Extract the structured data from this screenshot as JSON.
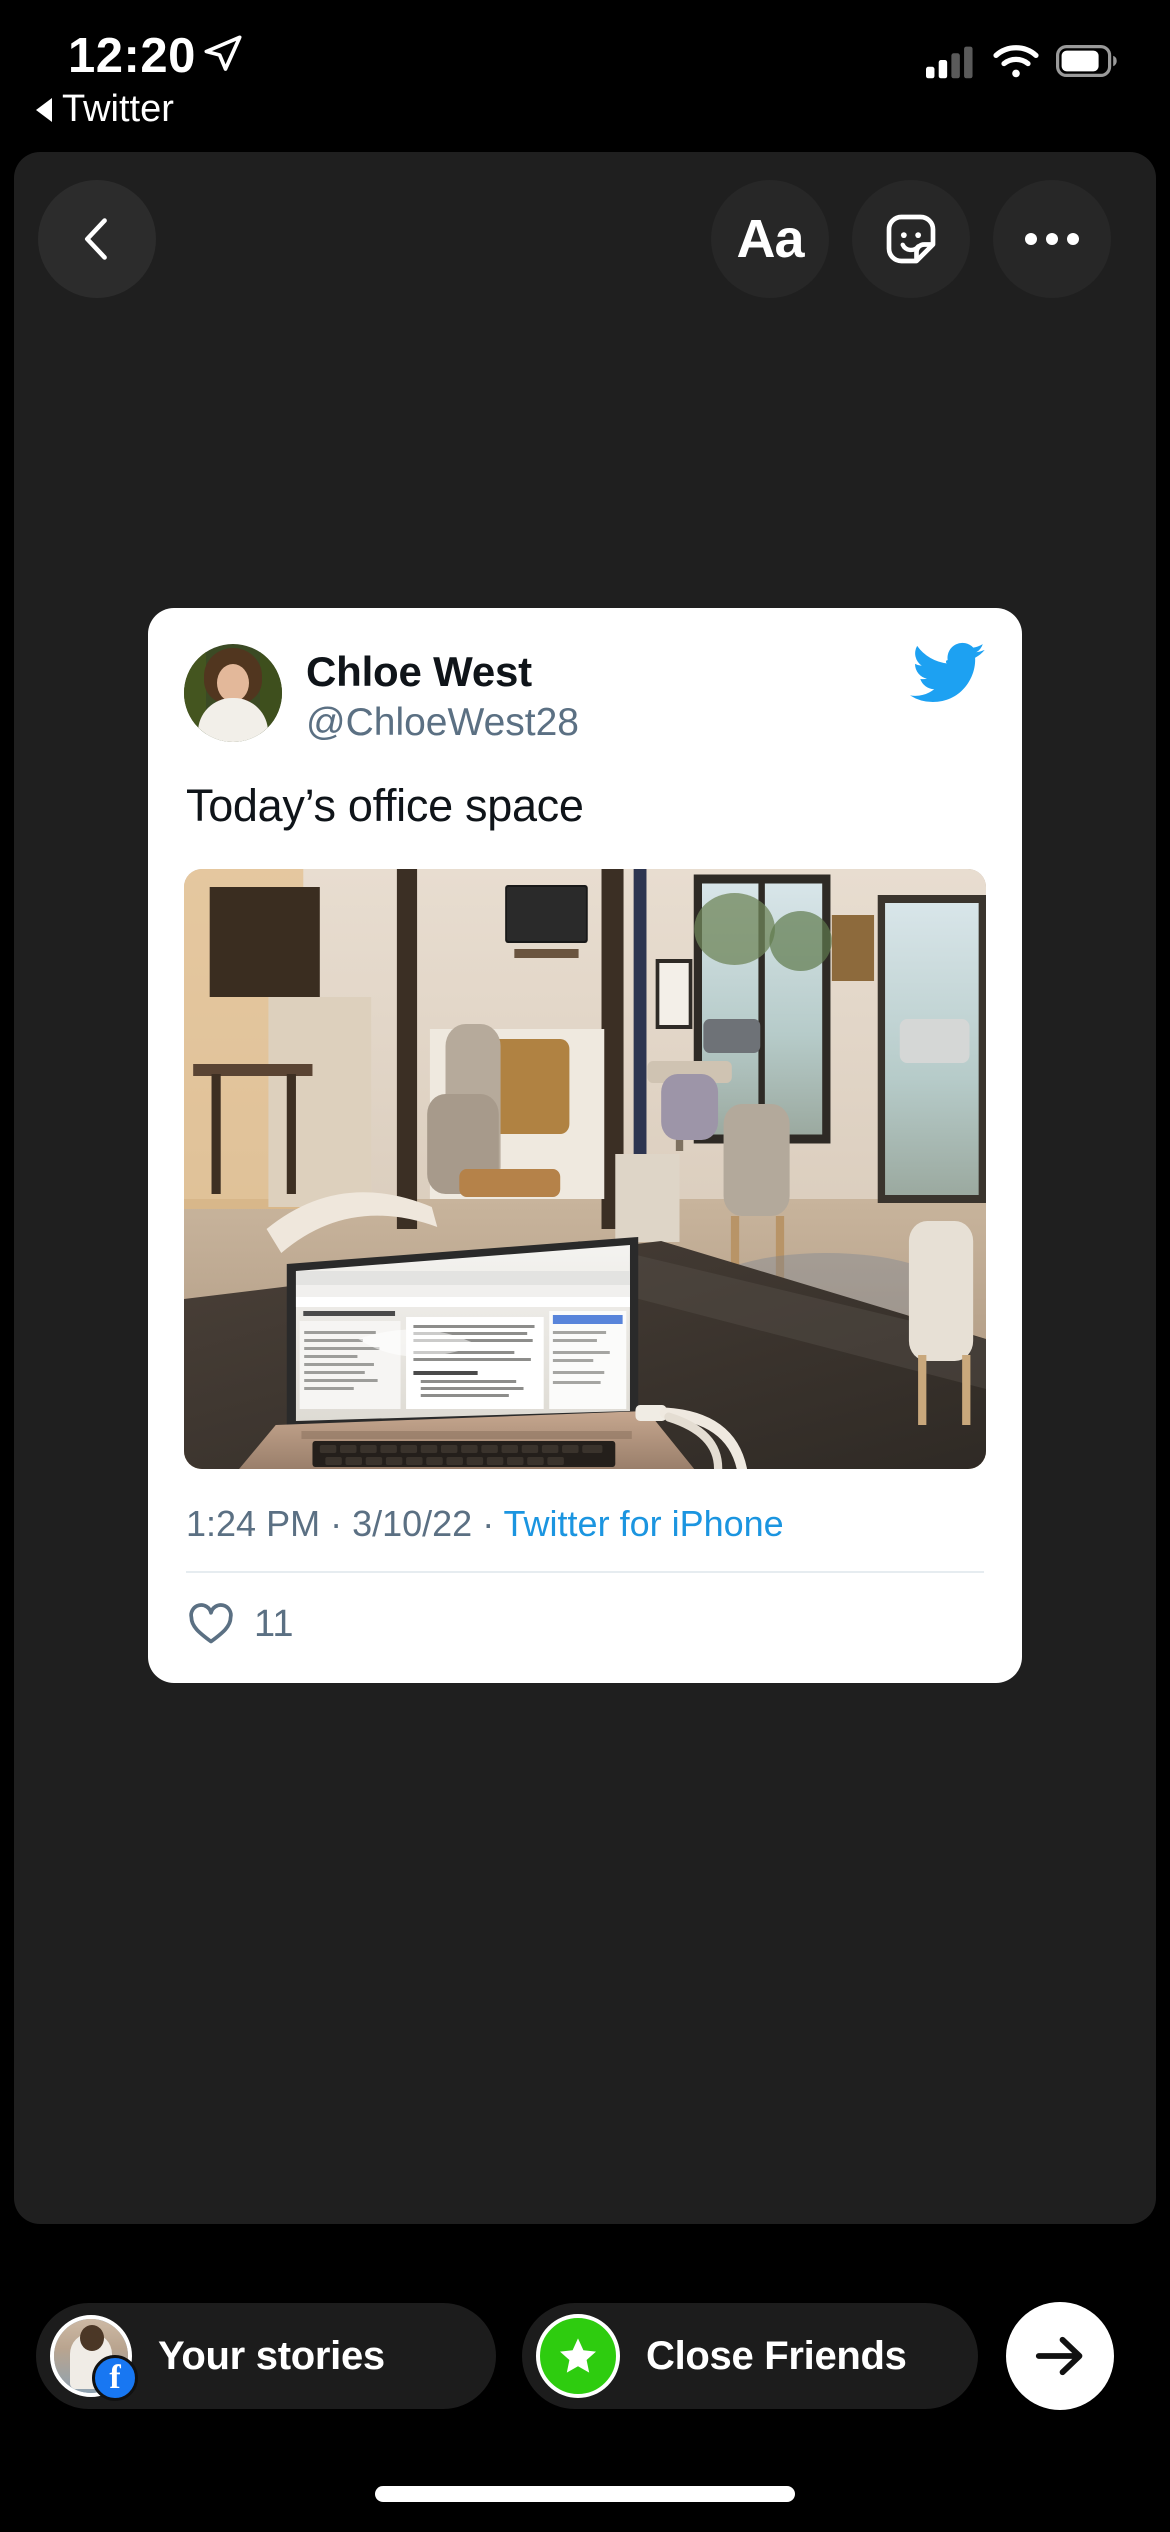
{
  "status_bar": {
    "time": "12:20",
    "location_icon": "location-arrow-icon",
    "back_app_label": "Twitter",
    "cellular_icon": "cellular-signal-icon",
    "cellular_bars_filled": 2,
    "cellular_bars_total": 4,
    "wifi_icon": "wifi-icon",
    "battery_icon": "battery-icon",
    "battery_level_pct": 78
  },
  "story_header": {
    "back_label": "back-chevron-icon",
    "text_tool_label": "Aa",
    "sticker_label": "sticker-icon",
    "more_label": "more-options-icon"
  },
  "tweet_card": {
    "display_name": "Chloe West",
    "handle": "@ChloeWest28",
    "logo": "twitter-bird-icon",
    "text": "Today’s office space",
    "photo_alt": "MacBook Pro open on a dark desk in a bright coworking lounge",
    "time": "1:24 PM",
    "separator_1": " · ",
    "date": "3/10/22",
    "separator_2": " · ",
    "source": "Twitter for iPhone",
    "like_icon": "heart-outline-icon",
    "like_count": "11"
  },
  "bottom_bar": {
    "your_stories_label": "Your stories",
    "your_stories_badge": "facebook-badge-icon",
    "facebook_letter": "f",
    "close_friends_label": "Close Friends",
    "close_friends_badge": "green-star-icon",
    "send_label": "send-arrow-icon"
  },
  "colors": {
    "background": "#000000",
    "canvas": "#1f1f1f",
    "card": "#ffffff",
    "twitter_blue": "#1DA1F2",
    "link_blue": "#1b95e0",
    "muted_text": "#5b7083",
    "close_friends_green": "#2ECC0F",
    "facebook_blue": "#1877F2"
  }
}
